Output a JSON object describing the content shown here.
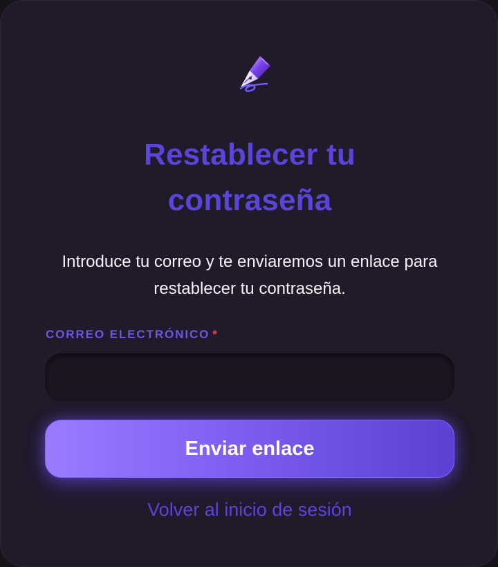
{
  "reset_password": {
    "logo_icon": "fountain-pen-icon",
    "title_line_1": "Restablecer tu",
    "title_line_2": "contraseña",
    "description": "Introduce tu correo y te enviaremos un enlace para restablecer tu contraseña.",
    "email_label": "CORREO ELECTRÓNICO",
    "required_marker": "*",
    "email_value": "",
    "submit_label": "Enviar enlace",
    "back_link_label": "Volver al inicio de sesión",
    "colors": {
      "background": "#211a2a",
      "accent": "#5b45d9",
      "required": "#e8464f",
      "button_start": "#9a7bff",
      "button_end": "#5c3fd3"
    }
  }
}
